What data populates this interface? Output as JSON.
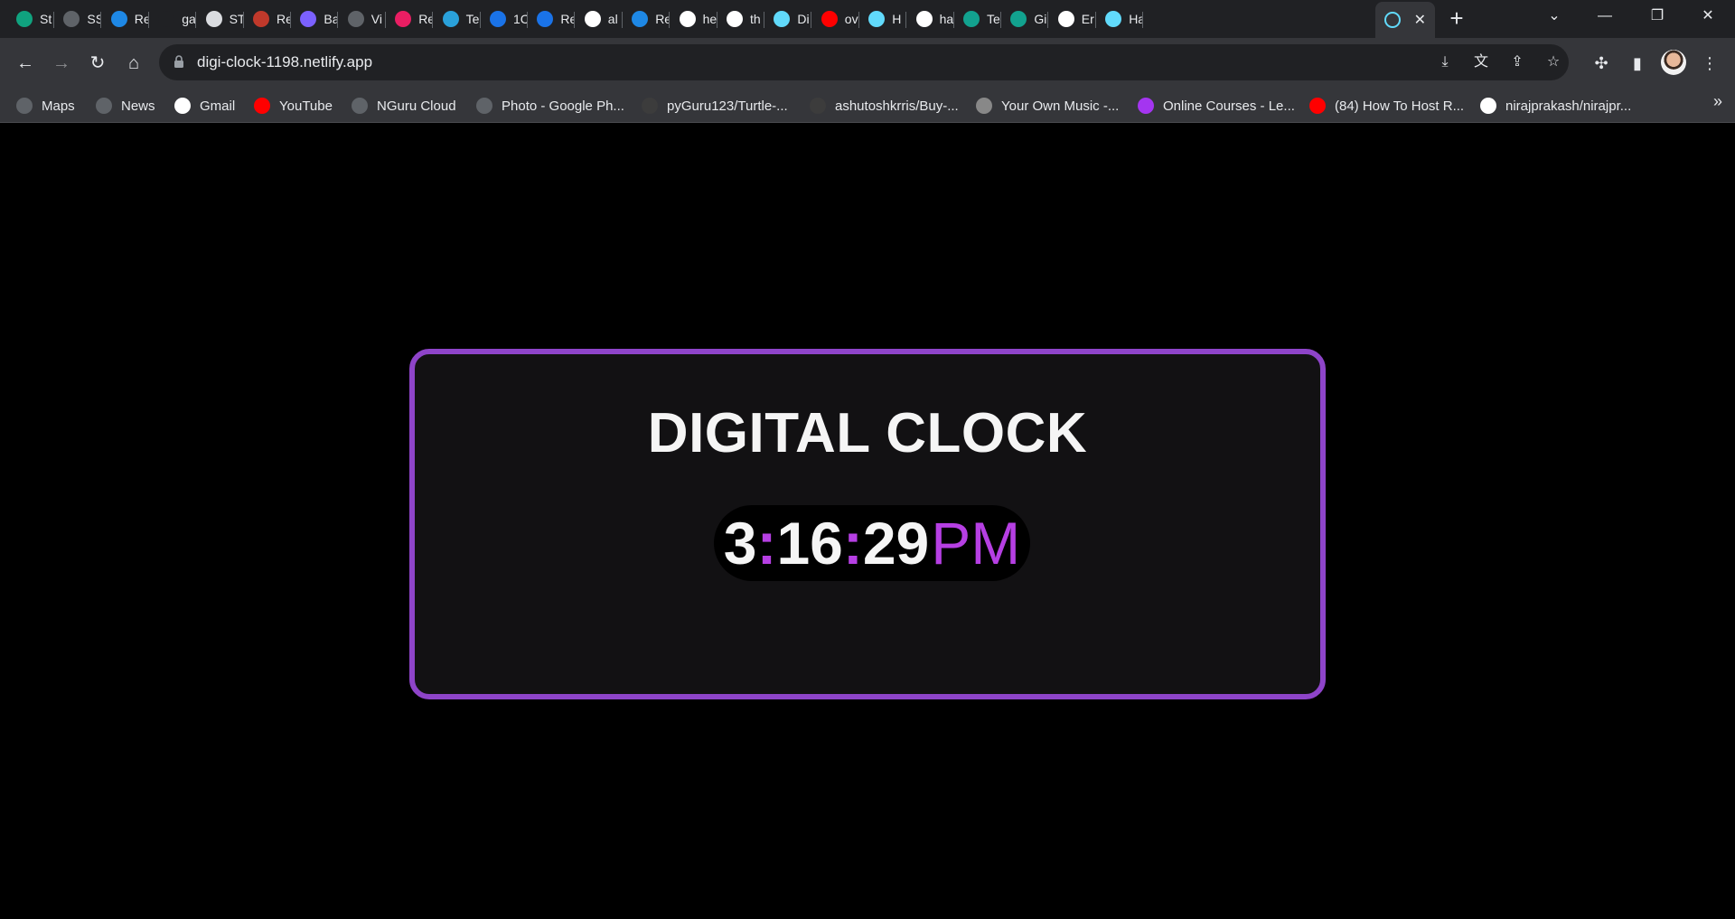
{
  "browser": {
    "tabs": [
      {
        "label": "St",
        "icon": "openai-icon",
        "color": "#10a37f"
      },
      {
        "label": "SS",
        "icon": "globe-icon",
        "color": "#5f6368"
      },
      {
        "label": "Re",
        "icon": "mui-icon",
        "color": "#1e88e5"
      },
      {
        "label": "ga",
        "icon": "square-icon",
        "color": "#202124"
      },
      {
        "label": "ST",
        "icon": "doc-icon",
        "color": "#dadce0"
      },
      {
        "label": "Re",
        "icon": "seal-icon",
        "color": "#c0392b"
      },
      {
        "label": "Ba",
        "icon": "sparkle-icon",
        "color": "#7b61ff"
      },
      {
        "label": "Vi",
        "icon": "globe-icon",
        "color": "#5f6368"
      },
      {
        "label": "Re",
        "icon": "react-icon",
        "color": "#e91e63"
      },
      {
        "label": "Te",
        "icon": "telegram-icon",
        "color": "#2aa1da"
      },
      {
        "label": "1C",
        "icon": "codeium-icon",
        "color": "#1a73e8"
      },
      {
        "label": "Re",
        "icon": "codeium-icon",
        "color": "#1a73e8"
      },
      {
        "label": "al",
        "icon": "google-icon",
        "color": "#ffffff"
      },
      {
        "label": "Re",
        "icon": "mui-icon",
        "color": "#1e88e5"
      },
      {
        "label": "he",
        "icon": "google-icon",
        "color": "#ffffff"
      },
      {
        "label": "th",
        "icon": "github-icon",
        "color": "#ffffff"
      },
      {
        "label": "Di",
        "icon": "react-icon",
        "color": "#61dafb"
      },
      {
        "label": "ov",
        "icon": "youtube-icon",
        "color": "#ff0000"
      },
      {
        "label": "H",
        "icon": "react-icon",
        "color": "#61dafb"
      },
      {
        "label": "ha",
        "icon": "github-icon",
        "color": "#ffffff"
      },
      {
        "label": "Te",
        "icon": "diamond-icon",
        "color": "#12a28f"
      },
      {
        "label": "Gi",
        "icon": "diamond-icon",
        "color": "#12a28f"
      },
      {
        "label": "Er",
        "icon": "google-icon",
        "color": "#ffffff"
      },
      {
        "label": "Ha",
        "icon": "react-icon",
        "color": "#61dafb"
      }
    ],
    "active_tab": {
      "icon": "react-icon",
      "color": "#61dafb",
      "close": "✕"
    },
    "new_tab": "+",
    "controls": {
      "dropdown": "⌄",
      "minimize": "—",
      "restore": "❐",
      "close": "✕"
    },
    "nav": {
      "back": "←",
      "forward": "→",
      "reload": "↻",
      "home": "⌂"
    },
    "url": "digi-clock-1198.netlify.app",
    "omnibox_icons": [
      "install-icon",
      "translate-icon",
      "share-icon",
      "star-icon"
    ],
    "toolbar_icons": [
      "extensions-icon",
      "sidepanel-icon",
      "profile-avatar",
      "menu-icon"
    ],
    "bookmarks": [
      {
        "label": "Maps",
        "icon": "globe-icon",
        "color": "#5f6368"
      },
      {
        "label": "News",
        "icon": "globe-icon",
        "color": "#5f6368"
      },
      {
        "label": "Gmail",
        "icon": "google-icon",
        "color": "#ffffff"
      },
      {
        "label": "YouTube",
        "icon": "youtube-icon",
        "color": "#ff0000"
      },
      {
        "label": "NGuru Cloud",
        "icon": "globe-icon",
        "color": "#5f6368"
      },
      {
        "label": "Photo - Google Ph...",
        "icon": "globe-icon",
        "color": "#5f6368"
      },
      {
        "label": "pyGuru123/Turtle-...",
        "icon": "github-icon",
        "color": "#3c3c3c"
      },
      {
        "label": "ashutoshkrris/Buy-...",
        "icon": "github-icon",
        "color": "#3c3c3c"
      },
      {
        "label": "Your Own Music -...",
        "icon": "music-icon",
        "color": "#888888"
      },
      {
        "label": "Online Courses - Le...",
        "icon": "udemy-icon",
        "color": "#a435f0"
      },
      {
        "label": "(84) How To Host R...",
        "icon": "youtube-icon",
        "color": "#ff0000"
      },
      {
        "label": "nirajprakash/nirajpr...",
        "icon": "github-icon",
        "color": "#ffffff"
      }
    ],
    "bookmarks_more": "»"
  },
  "clock": {
    "title": "DIGITAL CLOCK",
    "hours": "3",
    "minutes": "16",
    "seconds": "29",
    "separator": ":",
    "period": "PM",
    "accent_color": "#b63fe3",
    "border_color": "#8e44c9"
  }
}
